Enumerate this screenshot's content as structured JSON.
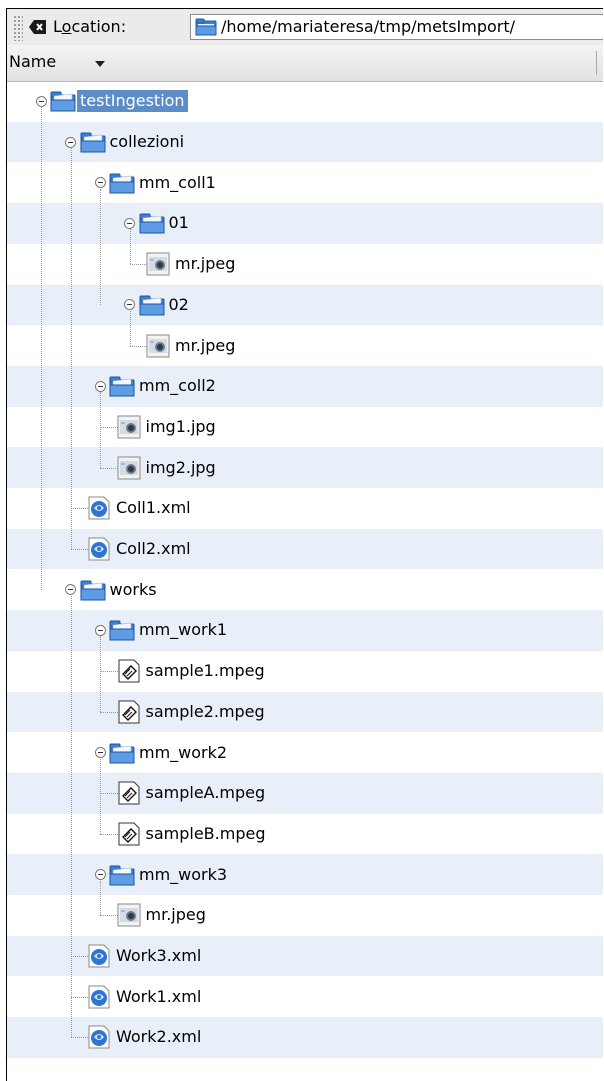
{
  "location": {
    "label_prefix": "L",
    "label_underlined": "o",
    "label_suffix": "cation:",
    "path": "/home/mariateresa/tmp/metsImport/"
  },
  "column": {
    "name_header": "Name"
  },
  "tree": [
    {
      "label": "testIngestion",
      "kind": "folder",
      "depth": 0,
      "expanded": true,
      "selected": true
    },
    {
      "label": "collezioni",
      "kind": "folder",
      "depth": 1,
      "expanded": true
    },
    {
      "label": "mm_coll1",
      "kind": "folder",
      "depth": 2,
      "expanded": true
    },
    {
      "label": "01",
      "kind": "folder",
      "depth": 3,
      "expanded": true
    },
    {
      "label": "mr.jpeg",
      "kind": "image",
      "depth": 4
    },
    {
      "label": "02",
      "kind": "folder",
      "depth": 3,
      "expanded": true
    },
    {
      "label": "mr.jpeg",
      "kind": "image",
      "depth": 4
    },
    {
      "label": "mm_coll2",
      "kind": "folder",
      "depth": 2,
      "expanded": true
    },
    {
      "label": "img1.jpg",
      "kind": "image",
      "depth": 3
    },
    {
      "label": "img2.jpg",
      "kind": "image",
      "depth": 3
    },
    {
      "label": "Coll1.xml",
      "kind": "xml",
      "depth": 2
    },
    {
      "label": "Coll2.xml",
      "kind": "xml",
      "depth": 2
    },
    {
      "label": "works",
      "kind": "folder",
      "depth": 1,
      "expanded": true
    },
    {
      "label": "mm_work1",
      "kind": "folder",
      "depth": 2,
      "expanded": true
    },
    {
      "label": "sample1.mpeg",
      "kind": "video",
      "depth": 3
    },
    {
      "label": "sample2.mpeg",
      "kind": "video",
      "depth": 3
    },
    {
      "label": "mm_work2",
      "kind": "folder",
      "depth": 2,
      "expanded": true
    },
    {
      "label": "sampleA.mpeg",
      "kind": "video",
      "depth": 3
    },
    {
      "label": "sampleB.mpeg",
      "kind": "video",
      "depth": 3
    },
    {
      "label": "mm_work3",
      "kind": "folder",
      "depth": 2,
      "expanded": true
    },
    {
      "label": "mr.jpeg",
      "kind": "image",
      "depth": 3
    },
    {
      "label": "Work3.xml",
      "kind": "xml",
      "depth": 2
    },
    {
      "label": "Work1.xml",
      "kind": "xml",
      "depth": 2
    },
    {
      "label": "Work2.xml",
      "kind": "xml",
      "depth": 2
    }
  ],
  "colors": {
    "selection": "#5d8dc9",
    "alt_row": "#e9eff8",
    "folder": "#4a86d4"
  }
}
